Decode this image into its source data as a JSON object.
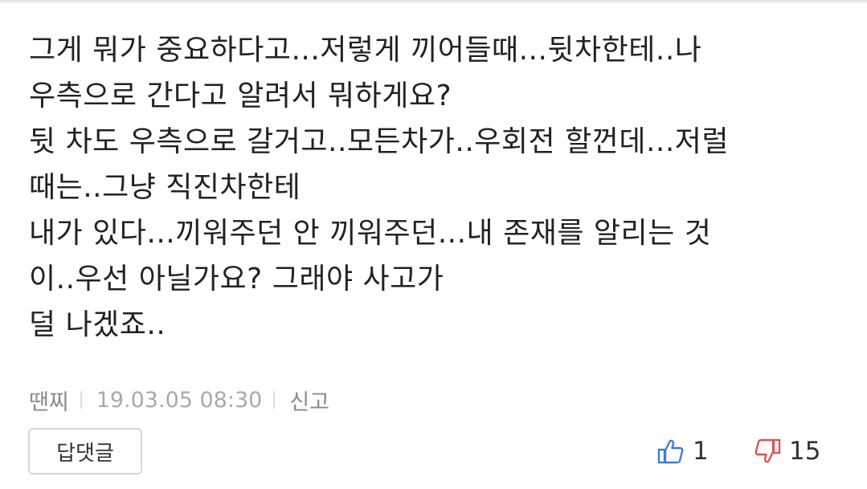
{
  "comment": {
    "lines": [
      "그게 뭐가 중요하다고...저렇게 끼어들때...뒷차한테..나",
      "우측으로 간다고 알려서 뭐하게요?",
      "뒷 차도 우측으로 갈거고..모든차가..우회전 할껀데...저럴",
      "때는..그냥 직진차한테",
      "내가 있다...끼워주던 안 끼워주던...내 존재를 알리는 것",
      "이..우선 아닐가요? 그래야 사고가",
      "덜 나겠죠.."
    ],
    "author": "땐찌",
    "timestamp": "19.03.05 08:30",
    "report_label": "신고"
  },
  "actions": {
    "reply_label": "답댓글",
    "like_count": "1",
    "dislike_count": "15",
    "like_icon": "thumbs-up-icon",
    "dislike_icon": "thumbs-down-icon"
  },
  "colors": {
    "like": "#3b7fd6",
    "dislike": "#e05252",
    "meta": "#aaaaaa"
  }
}
